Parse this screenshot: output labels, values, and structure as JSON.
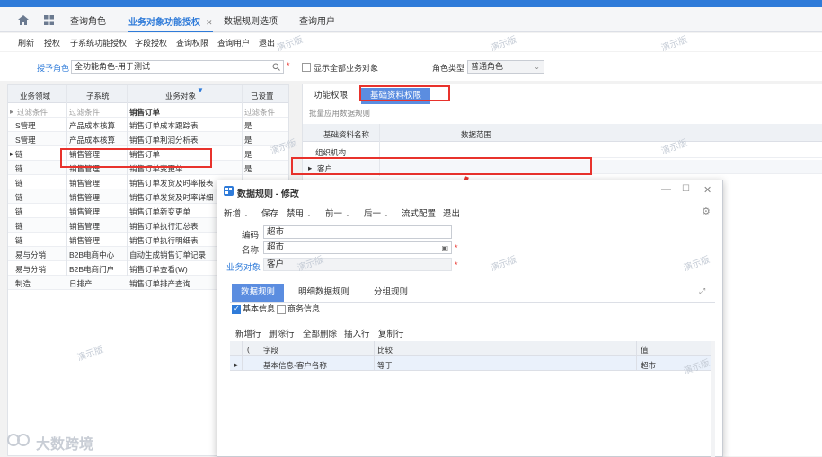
{
  "nav": {
    "tabs": [
      {
        "label": "查询角色"
      },
      {
        "label": "业务对象功能授权"
      },
      {
        "label": "数据规则选项"
      },
      {
        "label": "查询用户"
      }
    ]
  },
  "toolbar": [
    "刷新",
    "授权",
    "子系统功能授权",
    "字段授权",
    "查询权限",
    "查询用户",
    "退出"
  ],
  "filter": {
    "grant_role_label": "授予角色",
    "grant_role_value": "全功能角色-用于测试",
    "show_all_label": "显示全部业务对象",
    "role_type_label": "角色类型",
    "role_type_value": "普通角色"
  },
  "left_grid": {
    "headers": [
      "业务领域",
      "子系统",
      "业务对象",
      "已设置"
    ],
    "filter_row": [
      "过滤条件",
      "过滤条件",
      "销售订单",
      "过滤条件"
    ],
    "rows": [
      [
        "S管理",
        "产品成本核算",
        "销售订单成本跟踪表",
        "是"
      ],
      [
        "S管理",
        "产品成本核算",
        "销售订单利润分析表",
        "是"
      ],
      [
        "链",
        "销售管理",
        "销售订单",
        "是"
      ],
      [
        "链",
        "销售管理",
        "销售订单变更单",
        "是"
      ],
      [
        "链",
        "销售管理",
        "销售订单发货及时率报表",
        ""
      ],
      [
        "链",
        "销售管理",
        "销售订单发货及时率详细",
        ""
      ],
      [
        "链",
        "销售管理",
        "销售订单新变更单",
        ""
      ],
      [
        "链",
        "销售管理",
        "销售订单执行汇总表",
        ""
      ],
      [
        "链",
        "销售管理",
        "销售订单执行明细表",
        ""
      ],
      [
        "易与分销",
        "B2B电商中心",
        "自动生成销售订单记录",
        ""
      ],
      [
        "易与分销",
        "B2B电商门户",
        "销售订单查看(W)",
        ""
      ],
      [
        "制造",
        "日排产",
        "销售订单排产查询",
        ""
      ]
    ]
  },
  "right_panel": {
    "tabs": [
      "功能权限",
      "基础资料权限"
    ],
    "batch_label": "批量应用数据规则",
    "headers": [
      "基础资料名称",
      "数据范围"
    ],
    "rows": [
      "组织机构",
      "客户"
    ]
  },
  "modal": {
    "title": "数据规则 - 修改",
    "toolbar": [
      "新增",
      "保存",
      "禁用",
      "前一",
      "后一",
      "流式配置",
      "退出"
    ],
    "code_label": "编码",
    "code_value": "超市",
    "name_label": "名称",
    "name_value": "超市",
    "bizobj_label": "业务对象",
    "bizobj_value": "客户",
    "subtabs": [
      "数据规则",
      "明细数据规则",
      "分组规则"
    ],
    "chk_basic": "基本信息",
    "chk_business": "商务信息",
    "row_toolbar": [
      "新增行",
      "删除行",
      "全部删除",
      "插入行",
      "复制行"
    ],
    "grid_headers": [
      "(",
      "字段",
      "比较",
      "值"
    ],
    "grid_row": [
      "基本信息-客户名称",
      "等于",
      "超市"
    ]
  },
  "watermark": "演示版",
  "logo_text": "大数跨境"
}
